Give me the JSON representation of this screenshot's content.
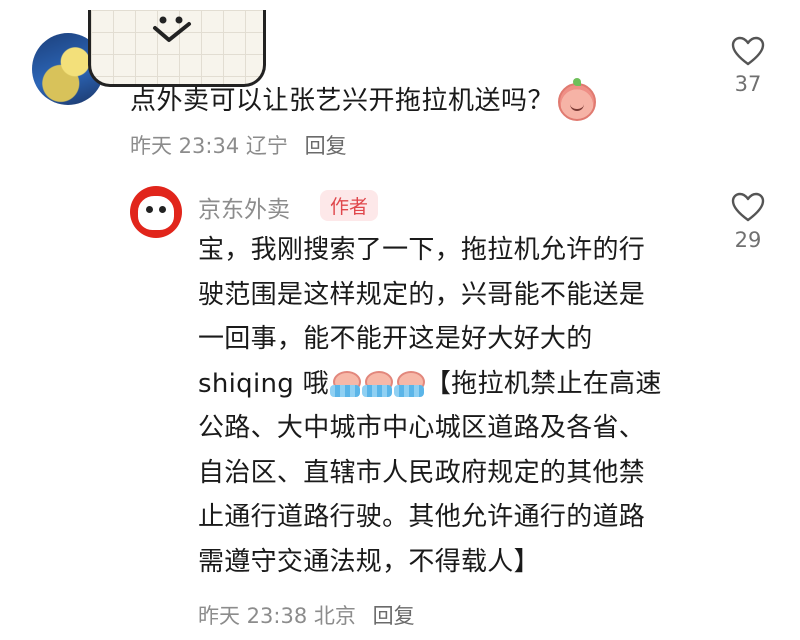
{
  "comment": {
    "text": "点外卖可以让张艺兴开拖拉机送吗？",
    "time": "昨天 23:34",
    "location": "辽宁",
    "reply_label": "回复",
    "likes": "37",
    "emoji_icon": "peach-face-emoji",
    "avatar_icon": "bird-avatar"
  },
  "reply": {
    "author": "京东外卖",
    "badge": "作者",
    "lines": [
      "宝，我刚搜索了一下，拖拉机允许的行",
      "驶范围是这样规定的，兴哥能不能送是",
      "一回事，能不能开这是好大好大的"
    ],
    "line4_prefix": "shiqing 哦",
    "line4_suffix": "【拖拉机禁止在高速",
    "lines_after": [
      "公路、大中城市中心城区道路及各省、",
      "自治区、直辖市人民政府规定的其他禁",
      "止通行道路行驶。其他允许通行的道路",
      "需遵守交通法规，不得载人】"
    ],
    "time": "昨天 23:38",
    "location": "北京",
    "reply_label": "回复",
    "likes": "29"
  },
  "colors": {
    "muted": "#8c8c8c",
    "badge_text": "#e0474c",
    "badge_bg": "#fde8e9",
    "brand_red": "#e1251b"
  }
}
